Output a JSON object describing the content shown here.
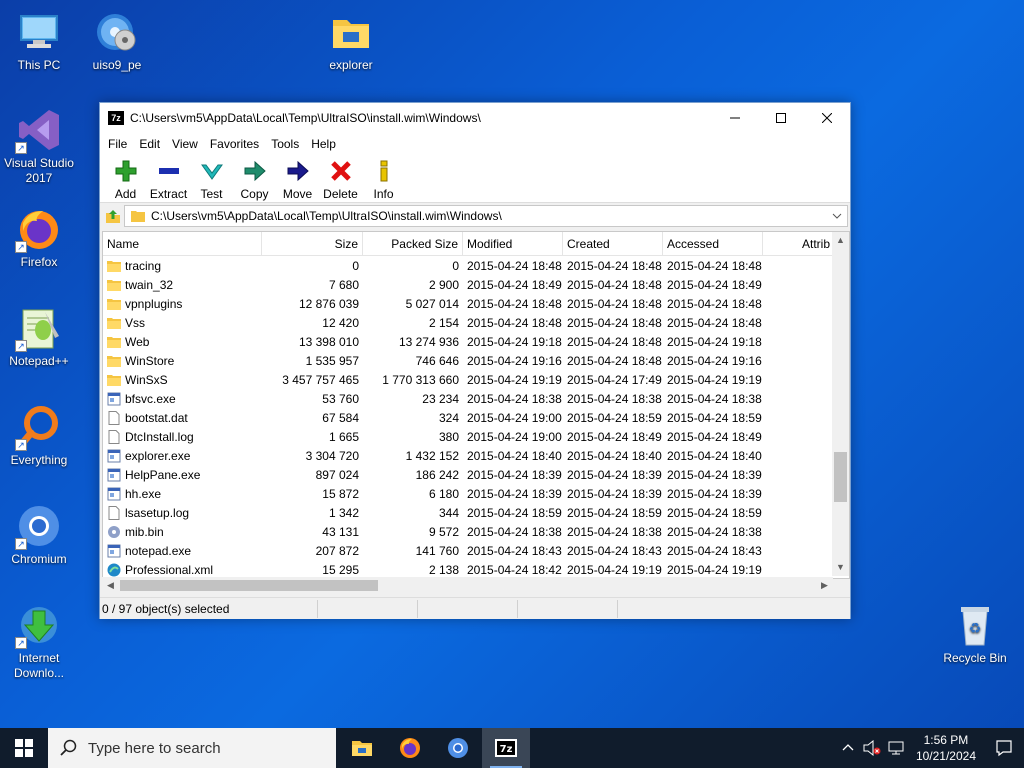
{
  "desktop": {
    "icons": [
      {
        "label": "This PC",
        "icon": "this-pc-icon"
      },
      {
        "label": "uiso9_pe",
        "icon": "disc-icon"
      },
      {
        "label": "explorer",
        "icon": "folder-icon"
      },
      {
        "label": "Visual Studio 2017",
        "icon": "visual-studio-icon"
      },
      {
        "label": "Firefox",
        "icon": "firefox-icon"
      },
      {
        "label": "Notepad++",
        "icon": "notepadpp-icon"
      },
      {
        "label": "Everything",
        "icon": "everything-icon"
      },
      {
        "label": "Chromium",
        "icon": "chromium-icon"
      },
      {
        "label": "Internet Downlo...",
        "icon": "idm-icon"
      },
      {
        "label": "Recycle Bin",
        "icon": "recycle-bin-icon"
      }
    ]
  },
  "window": {
    "title": "C:\\Users\\vm5\\AppData\\Local\\Temp\\UltraISO\\install.wim\\Windows\\",
    "app_icon_text": "7z",
    "menu": [
      "File",
      "Edit",
      "View",
      "Favorites",
      "Tools",
      "Help"
    ],
    "toolbar": [
      {
        "label": "Add",
        "icon": "add-icon",
        "color": "#2ea02e"
      },
      {
        "label": "Extract",
        "icon": "extract-icon",
        "color": "#1c2fb0"
      },
      {
        "label": "Test",
        "icon": "test-icon",
        "color": "#20b8b8"
      },
      {
        "label": "Copy",
        "icon": "copy-icon",
        "color": "#1f8c6c"
      },
      {
        "label": "Move",
        "icon": "move-icon",
        "color": "#1a1a8c"
      },
      {
        "label": "Delete",
        "icon": "delete-icon",
        "color": "#e01010"
      },
      {
        "label": "Info",
        "icon": "info-icon",
        "color": "#c8a000"
      }
    ],
    "address": "C:\\Users\\vm5\\AppData\\Local\\Temp\\UltraISO\\install.wim\\Windows\\",
    "columns": [
      "Name",
      "Size",
      "Packed Size",
      "Modified",
      "Created",
      "Accessed",
      "Attrib"
    ],
    "rows": [
      {
        "name": "tracing",
        "type": "folder",
        "size": "0",
        "packed": "0",
        "modified": "2015-04-24 18:48",
        "created": "2015-04-24 18:48",
        "accessed": "2015-04-24 18:48"
      },
      {
        "name": "twain_32",
        "type": "folder",
        "size": "7 680",
        "packed": "2 900",
        "modified": "2015-04-24 18:49",
        "created": "2015-04-24 18:48",
        "accessed": "2015-04-24 18:49"
      },
      {
        "name": "vpnplugins",
        "type": "folder",
        "size": "12 876 039",
        "packed": "5 027 014",
        "modified": "2015-04-24 18:48",
        "created": "2015-04-24 18:48",
        "accessed": "2015-04-24 18:48"
      },
      {
        "name": "Vss",
        "type": "folder",
        "size": "12 420",
        "packed": "2 154",
        "modified": "2015-04-24 18:48",
        "created": "2015-04-24 18:48",
        "accessed": "2015-04-24 18:48"
      },
      {
        "name": "Web",
        "type": "folder",
        "size": "13 398 010",
        "packed": "13 274 936",
        "modified": "2015-04-24 19:18",
        "created": "2015-04-24 18:48",
        "accessed": "2015-04-24 19:18"
      },
      {
        "name": "WinStore",
        "type": "folder",
        "size": "1 535 957",
        "packed": "746 646",
        "modified": "2015-04-24 19:16",
        "created": "2015-04-24 18:48",
        "accessed": "2015-04-24 19:16"
      },
      {
        "name": "WinSxS",
        "type": "folder",
        "size": "3 457 757 465",
        "packed": "1 770 313 660",
        "modified": "2015-04-24 19:19",
        "created": "2015-04-24 17:49",
        "accessed": "2015-04-24 19:19"
      },
      {
        "name": "bfsvc.exe",
        "type": "exe",
        "size": "53 760",
        "packed": "23 234",
        "modified": "2015-04-24 18:38",
        "created": "2015-04-24 18:38",
        "accessed": "2015-04-24 18:38"
      },
      {
        "name": "bootstat.dat",
        "type": "file",
        "size": "67 584",
        "packed": "324",
        "modified": "2015-04-24 19:00",
        "created": "2015-04-24 18:59",
        "accessed": "2015-04-24 18:59"
      },
      {
        "name": "DtcInstall.log",
        "type": "file",
        "size": "1 665",
        "packed": "380",
        "modified": "2015-04-24 19:00",
        "created": "2015-04-24 18:49",
        "accessed": "2015-04-24 18:49"
      },
      {
        "name": "explorer.exe",
        "type": "exe",
        "size": "3 304 720",
        "packed": "1 432 152",
        "modified": "2015-04-24 18:40",
        "created": "2015-04-24 18:40",
        "accessed": "2015-04-24 18:40"
      },
      {
        "name": "HelpPane.exe",
        "type": "exe",
        "size": "897 024",
        "packed": "186 242",
        "modified": "2015-04-24 18:39",
        "created": "2015-04-24 18:39",
        "accessed": "2015-04-24 18:39"
      },
      {
        "name": "hh.exe",
        "type": "exe",
        "size": "15 872",
        "packed": "6 180",
        "modified": "2015-04-24 18:39",
        "created": "2015-04-24 18:39",
        "accessed": "2015-04-24 18:39"
      },
      {
        "name": "lsasetup.log",
        "type": "file",
        "size": "1 342",
        "packed": "344",
        "modified": "2015-04-24 18:59",
        "created": "2015-04-24 18:59",
        "accessed": "2015-04-24 18:59"
      },
      {
        "name": "mib.bin",
        "type": "bin",
        "size": "43 131",
        "packed": "9 572",
        "modified": "2015-04-24 18:38",
        "created": "2015-04-24 18:38",
        "accessed": "2015-04-24 18:38"
      },
      {
        "name": "notepad.exe",
        "type": "exe",
        "size": "207 872",
        "packed": "141 760",
        "modified": "2015-04-24 18:43",
        "created": "2015-04-24 18:43",
        "accessed": "2015-04-24 18:43"
      },
      {
        "name": "Professional.xml",
        "type": "xml",
        "size": "15 295",
        "packed": "2 138",
        "modified": "2015-04-24 18:42",
        "created": "2015-04-24 19:19",
        "accessed": "2015-04-24 19:19"
      }
    ],
    "status": "0 / 97 object(s) selected"
  },
  "taskbar": {
    "search_placeholder": "Type here to search",
    "apps": [
      {
        "name": "file-explorer",
        "icon": "file-explorer-icon",
        "state": "normal"
      },
      {
        "name": "firefox",
        "icon": "firefox-icon",
        "state": "normal"
      },
      {
        "name": "chromium",
        "icon": "chromium-icon",
        "state": "normal"
      },
      {
        "name": "7zip",
        "icon": "7zip-icon",
        "state": "active"
      }
    ],
    "time": "1:56 PM",
    "date": "10/21/2024"
  }
}
